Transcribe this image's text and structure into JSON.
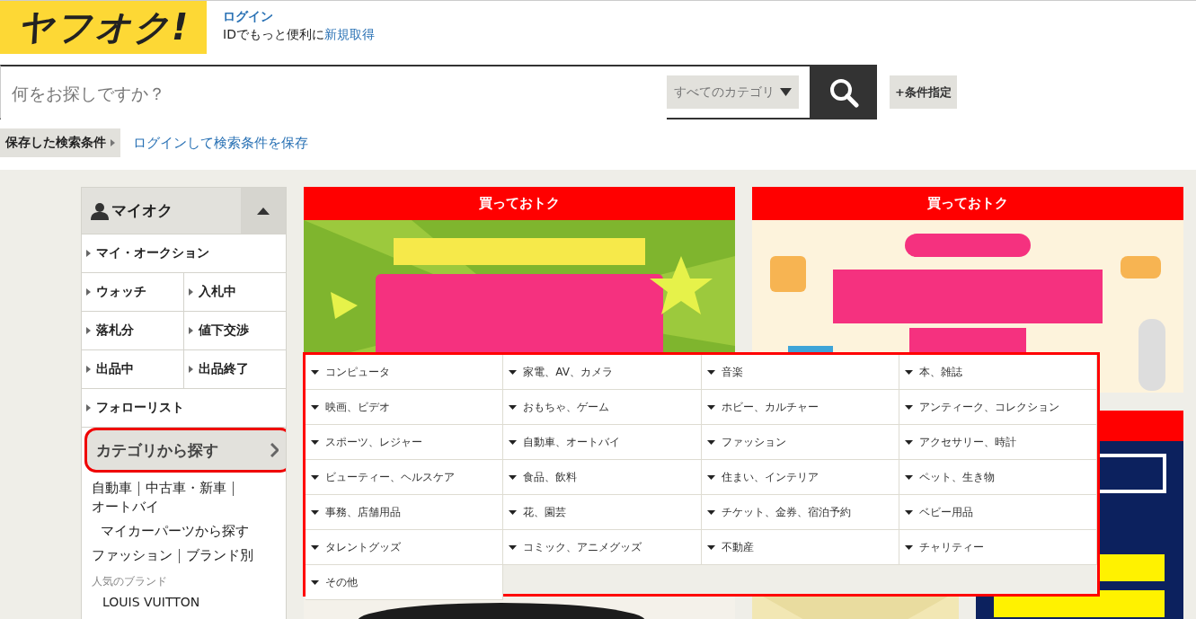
{
  "header": {
    "logo": "ヤフオク!",
    "login": "ログイン",
    "id_note": "IDでもっと便利に",
    "signup": "新規取得"
  },
  "search": {
    "placeholder": "何をお探しですか？",
    "category": "すべてのカテゴリ",
    "advanced": "+条件指定"
  },
  "saved_search": {
    "label": "保存した検索条件",
    "link": "ログインして検索条件を保存"
  },
  "sidebar": {
    "title": "マイオク",
    "expanded": true,
    "menu_rows": [
      [
        "マイ・オークション"
      ],
      [
        "ウォッチ",
        "入札中"
      ],
      [
        "落札分",
        "値下交渉"
      ],
      [
        "出品中",
        "出品終了"
      ],
      [
        "フォローリスト"
      ]
    ],
    "category_button": {
      "label": "カテゴリから探す",
      "selected": true
    },
    "category_links": [
      {
        "kind": "main",
        "links": [
          "自動車",
          "中古車・新車",
          "オートバイ"
        ]
      },
      {
        "kind": "sub",
        "links": [
          "マイカーパーツから探す"
        ]
      },
      {
        "kind": "main",
        "links": [
          "ファッション",
          "ブランド別"
        ]
      }
    ],
    "popular_brands_label": "人気のブランド",
    "brands": [
      "LOUIS VUITTON"
    ]
  },
  "banners": [
    {
      "title": "買っておトク",
      "kind": "picture"
    },
    {
      "title": "買っておトク",
      "kind": "picture"
    }
  ],
  "category_menu": [
    "コンピュータ",
    "家電、AV、カメラ",
    "音楽",
    "本、雑誌",
    "映画、ビデオ",
    "おもちゃ、ゲーム",
    "ホビー、カルチャー",
    "アンティーク、コレクション",
    "スポーツ、レジャー",
    "自動車、オートバイ",
    "ファッション",
    "アクセサリー、時計",
    "ビューティー、ヘルスケア",
    "食品、飲料",
    "住まい、インテリア",
    "ペット、生き物",
    "事務、店舗用品",
    "花、園芸",
    "チケット、金券、宿泊予約",
    "ベビー用品",
    "タレントグッズ",
    "コミック、アニメグッズ",
    "不動産",
    "チャリティー",
    "その他"
  ]
}
